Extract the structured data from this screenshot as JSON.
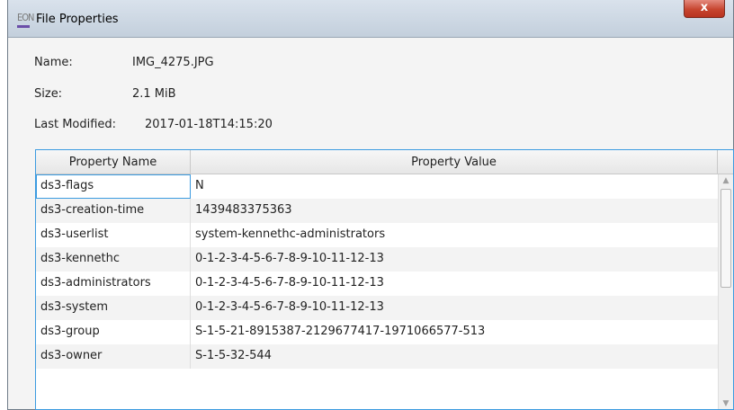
{
  "window": {
    "title": "File Properties",
    "app_icon_text": "EON",
    "close_glyph": "x"
  },
  "info": {
    "name_label": "Name:",
    "name_value": "IMG_4275.JPG",
    "size_label": "Size:",
    "size_value": "2.1 MiB",
    "modified_label": "Last Modified:",
    "modified_value": "2017-01-18T14:15:20"
  },
  "table": {
    "columns": [
      "Property Name",
      "Property Value"
    ],
    "rows": [
      {
        "name": "ds3-flags",
        "value": "N"
      },
      {
        "name": "ds3-creation-time",
        "value": "1439483375363"
      },
      {
        "name": "ds3-userlist",
        "value": "system-kennethc-administrators"
      },
      {
        "name": "ds3-kennethc",
        "value": "0-1-2-3-4-5-6-7-8-9-10-11-12-13"
      },
      {
        "name": "ds3-administrators",
        "value": "0-1-2-3-4-5-6-7-8-9-10-11-12-13"
      },
      {
        "name": "ds3-system",
        "value": "0-1-2-3-4-5-6-7-8-9-10-11-12-13"
      },
      {
        "name": "ds3-group",
        "value": "S-1-5-21-8915387-2129677417-1971066577-513"
      },
      {
        "name": "ds3-owner",
        "value": "S-1-5-32-544"
      }
    ]
  },
  "colors": {
    "selection_border": "#3c9be0",
    "close_button": "#c7452f"
  }
}
